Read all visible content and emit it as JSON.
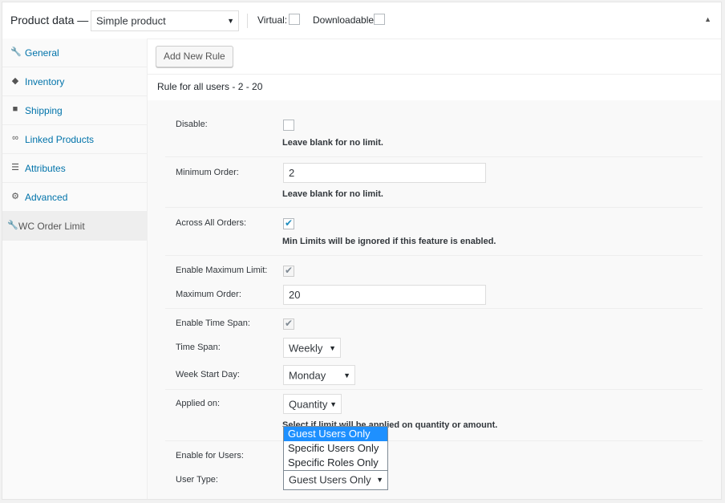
{
  "header": {
    "title": "Product data —",
    "product_type": "Simple product",
    "virtual_label": "Virtual:",
    "downloadable_label": "Downloadable:"
  },
  "sidebar": {
    "items": [
      {
        "label": "General",
        "icon": "wrench-icon"
      },
      {
        "label": "Inventory",
        "icon": "tag-icon"
      },
      {
        "label": "Shipping",
        "icon": "truck-icon"
      },
      {
        "label": "Linked Products",
        "icon": "link-icon"
      },
      {
        "label": "Attributes",
        "icon": "list-icon"
      },
      {
        "label": "Advanced",
        "icon": "gear-icon"
      },
      {
        "label": "WC Order Limit",
        "icon": "wrench-icon",
        "active": true
      }
    ]
  },
  "main": {
    "add_rule_button": "Add New Rule",
    "rule_title": "Rule for all users - 2 - 20"
  },
  "form": {
    "disable_label": "Disable:",
    "disable_help": "Leave blank for no limit.",
    "min_order_label": "Minimum Order:",
    "min_order_value": "2",
    "min_order_help": "Leave blank for no limit.",
    "across_label": "Across All Orders:",
    "across_help": "Min Limits will be ignored if this feature is enabled.",
    "enable_max_label": "Enable Maximum Limit:",
    "max_order_label": "Maximum Order:",
    "max_order_value": "20",
    "enable_time_label": "Enable Time Span:",
    "time_span_label": "Time Span:",
    "time_span_value": "Weekly",
    "week_start_label": "Week Start Day:",
    "week_start_value": "Monday",
    "applied_label": "Applied on:",
    "applied_value": "Quantity",
    "applied_help": "Select if limit will be applied on quantity or amount.",
    "enable_users_label": "Enable for Users:",
    "user_type_label": "User Type:",
    "user_type_value": "Guest Users Only",
    "user_type_options": [
      "Guest Users Only",
      "Specific Users Only",
      "Specific Roles Only"
    ]
  },
  "colors": {
    "link": "#0073aa",
    "highlight": "#1e90ff",
    "check": "#1e8cbe"
  }
}
